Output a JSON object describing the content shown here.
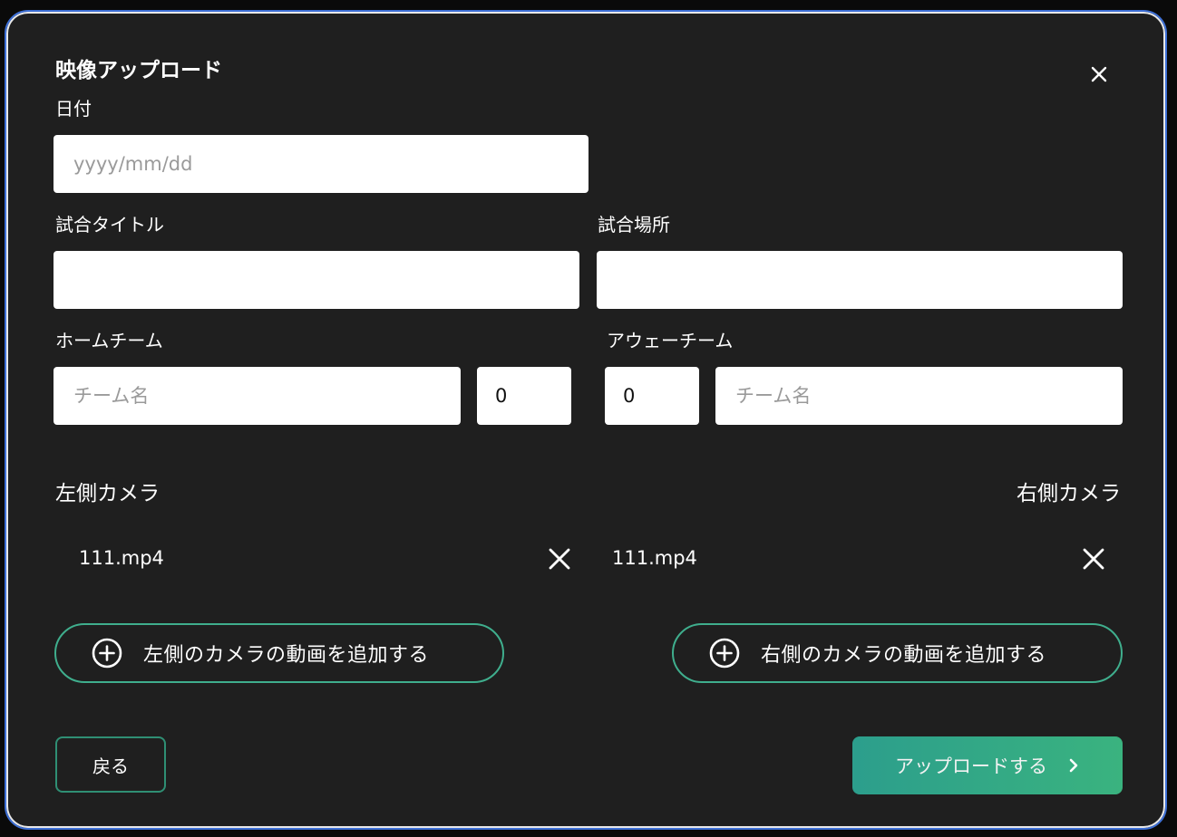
{
  "modal": {
    "title": "映像アップロード",
    "close_icon": "close-icon"
  },
  "form": {
    "date": {
      "label": "日付",
      "placeholder": "yyyy/mm/dd",
      "value": ""
    },
    "match_title": {
      "label": "試合タイトル",
      "value": ""
    },
    "match_location": {
      "label": "試合場所",
      "value": ""
    },
    "home_team": {
      "label": "ホームチーム",
      "name_placeholder": "チーム名",
      "name_value": "",
      "score": "0"
    },
    "away_team": {
      "label": "アウェーチーム",
      "name_placeholder": "チーム名",
      "name_value": "",
      "score": "0"
    }
  },
  "cameras": {
    "left": {
      "label": "左側カメラ",
      "files": [
        {
          "name": "111.mp4",
          "remove_icon": "close-icon"
        }
      ],
      "add_label": "左側のカメラの動画を追加する",
      "add_icon": "plus-circle-icon"
    },
    "right": {
      "label": "右側カメラ",
      "files": [
        {
          "name": "111.mp4",
          "remove_icon": "close-icon"
        }
      ],
      "add_label": "右側のカメラの動画を追加する",
      "add_icon": "plus-circle-icon"
    }
  },
  "footer": {
    "back_label": "戻る",
    "upload_label": "アップロードする",
    "upload_icon": "chevron-right-icon"
  },
  "colors": {
    "background": "#1f1f1f",
    "accent_green": "#3fae8d",
    "gradient_start": "#2c9e8c",
    "gradient_end": "#3ab37f",
    "modal_border": "#3d6fd6"
  }
}
